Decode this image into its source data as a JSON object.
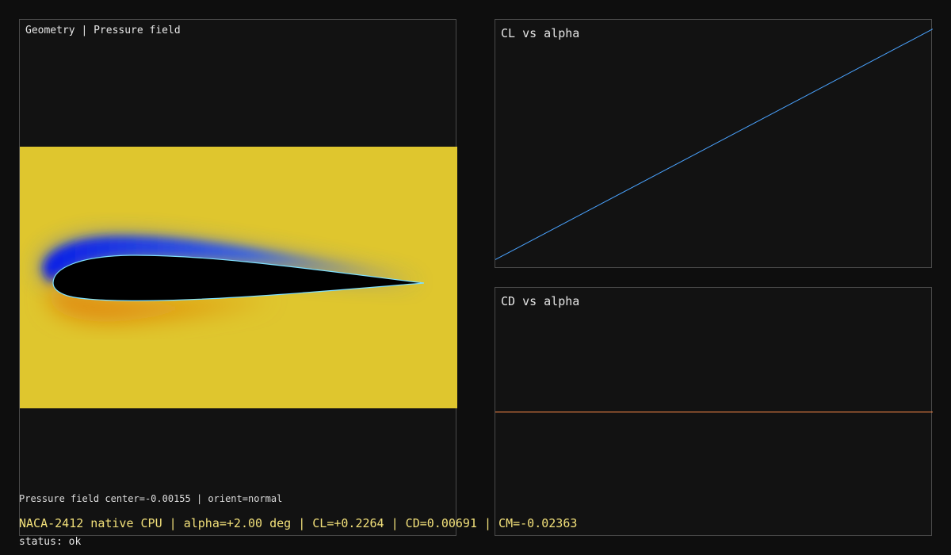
{
  "geometry_panel": {
    "title": "Geometry | Pressure field",
    "field_info": "Pressure field center=-0.00155 | orient=normal",
    "colors": {
      "freestream": "#dfc62e",
      "suction": "#0a1ee6",
      "suction_light": "#3a62e0",
      "pressure": "#e08a10",
      "airfoil": "#000000",
      "outline": "#7fe0ff"
    }
  },
  "summary_line": "NACA-2412 native CPU | alpha=+2.00 deg | CL=+0.2264 | CD=0.00691 | CM=-0.02363",
  "status_line": "status: ok",
  "chart_data": [
    {
      "type": "line",
      "title": "CL vs alpha",
      "xlabel": "",
      "ylabel": "",
      "x": [
        -10,
        10
      ],
      "series": [
        {
          "values": [
            -1.0,
            1.5
          ],
          "color": "#4aa3ff"
        }
      ],
      "xlim": [
        -10,
        10
      ],
      "ylim": [
        -1.1,
        1.6
      ],
      "grid": false
    },
    {
      "type": "line",
      "title": "CD vs alpha",
      "xlabel": "",
      "ylabel": "",
      "x": [
        -10,
        10
      ],
      "series": [
        {
          "values": [
            0.00691,
            0.00691
          ],
          "color": "#ff8c4a"
        }
      ],
      "xlim": [
        -10,
        10
      ],
      "ylim": [
        0.0,
        0.0138
      ],
      "grid": false
    }
  ]
}
